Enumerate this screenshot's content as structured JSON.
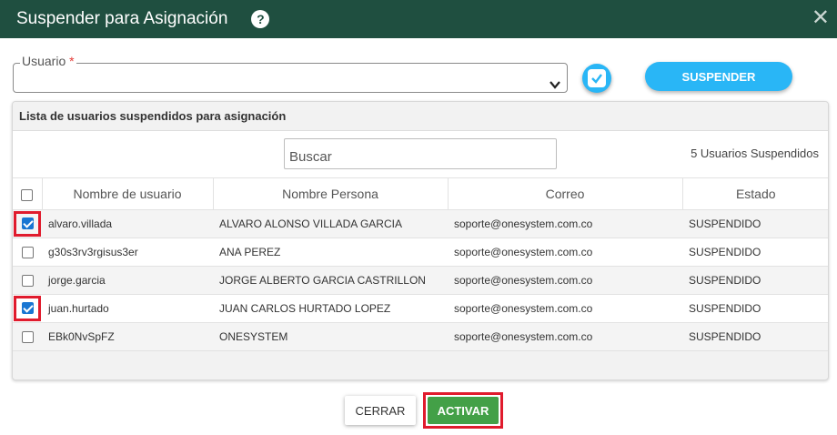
{
  "dialog": {
    "title": "Suspender para Asignación"
  },
  "icons": {
    "help": "help-icon",
    "close": "close-icon",
    "dropdown": "chevron-down-icon",
    "check": "checkmark-icon"
  },
  "form": {
    "usuario_label": "Usuario",
    "required_mark": "*",
    "usuario_value": "",
    "suspend_button": "SUSPENDER"
  },
  "panel": {
    "title": "Lista de usuarios suspendidos para asignación",
    "search_placeholder": "Buscar",
    "count_label": "5 Usuarios Suspendidos",
    "columns": [
      "Nombre de usuario",
      "Nombre Persona",
      "Correo",
      "Estado"
    ],
    "rows": [
      {
        "checked": true,
        "username": "alvaro.villada",
        "name": "ALVARO ALONSO VILLADA GARCIA",
        "email": "soporte@onesystem.com.co",
        "status": "SUSPENDIDO"
      },
      {
        "checked": false,
        "username": "g30s3rv3rgisus3er",
        "name": "ANA PEREZ",
        "email": "soporte@onesystem.com.co",
        "status": "SUSPENDIDO"
      },
      {
        "checked": false,
        "username": "jorge.garcia",
        "name": "JORGE ALBERTO GARCIA CASTRILLON",
        "email": "soporte@onesystem.com.co",
        "status": "SUSPENDIDO"
      },
      {
        "checked": true,
        "username": "juan.hurtado",
        "name": "JUAN CARLOS HURTADO LOPEZ",
        "email": "soporte@onesystem.com.co",
        "status": "SUSPENDIDO"
      },
      {
        "checked": false,
        "username": "EBk0NvSpFZ",
        "name": "ONESYSTEM",
        "email": "soporte@onesystem.com.co",
        "status": "SUSPENDIDO"
      }
    ]
  },
  "footer": {
    "close_button": "CERRAR",
    "activate_button": "ACTIVAR"
  },
  "colors": {
    "header": "#1f4f40",
    "accent": "#29b6f6",
    "activate": "#43a047",
    "highlight": "#e01b2d"
  }
}
